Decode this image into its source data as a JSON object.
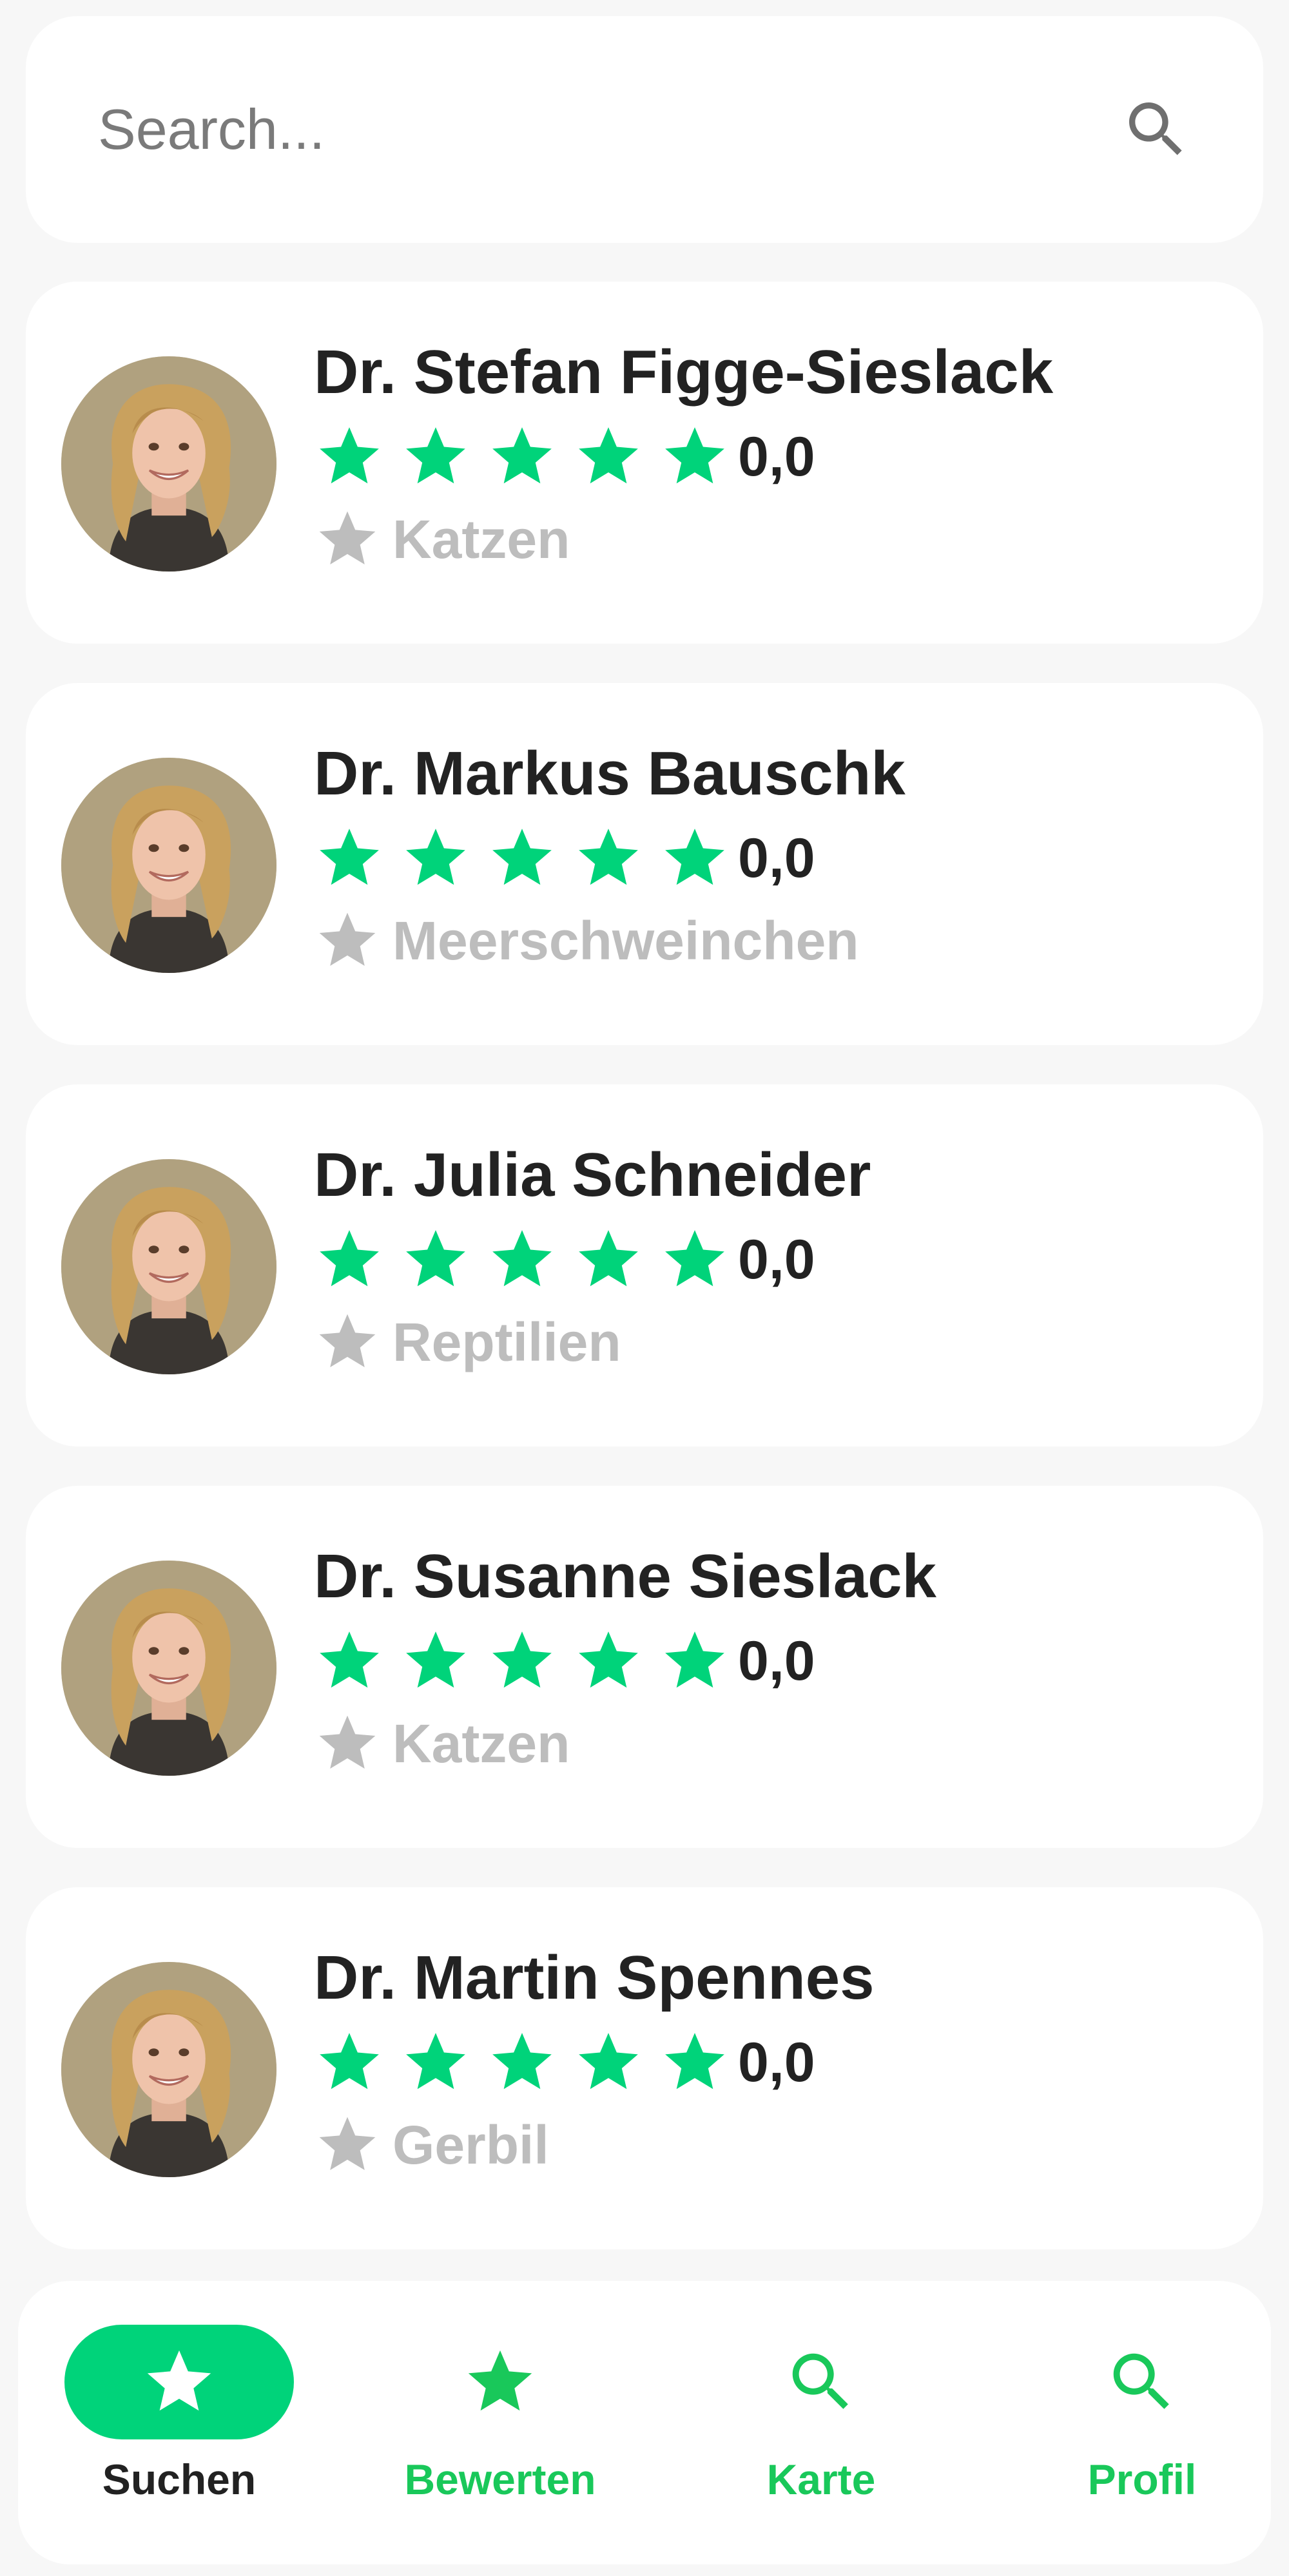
{
  "search": {
    "placeholder": "Search...",
    "value": "",
    "icon": "search-icon"
  },
  "vets": [
    {
      "name": "Dr. Stefan Figge-Sieslack",
      "stars": 5,
      "rating": "0,0",
      "category": "Katzen"
    },
    {
      "name": "Dr. Markus Bauschk",
      "stars": 5,
      "rating": "0,0",
      "category": "Meerschweinchen"
    },
    {
      "name": "Dr. Julia Schneider",
      "stars": 5,
      "rating": "0,0",
      "category": "Reptilien"
    },
    {
      "name": "Dr. Susanne Sieslack",
      "stars": 5,
      "rating": "0,0",
      "category": "Katzen"
    },
    {
      "name": "Dr. Martin Spennes",
      "stars": 5,
      "rating": "0,0",
      "category": "Gerbil"
    }
  ],
  "nav": [
    {
      "label": "Suchen",
      "icon": "star-icon",
      "active": true
    },
    {
      "label": "Bewerten",
      "icon": "star-icon",
      "active": false
    },
    {
      "label": "Karte",
      "icon": "search-icon",
      "active": false
    },
    {
      "label": "Profil",
      "icon": "search-icon",
      "active": false
    }
  ],
  "colors": {
    "accent": "#00d37a",
    "nav_text": "#19c85a",
    "category_gray": "#bdbdbd",
    "background": "#f7f7f7",
    "text": "#222222"
  }
}
